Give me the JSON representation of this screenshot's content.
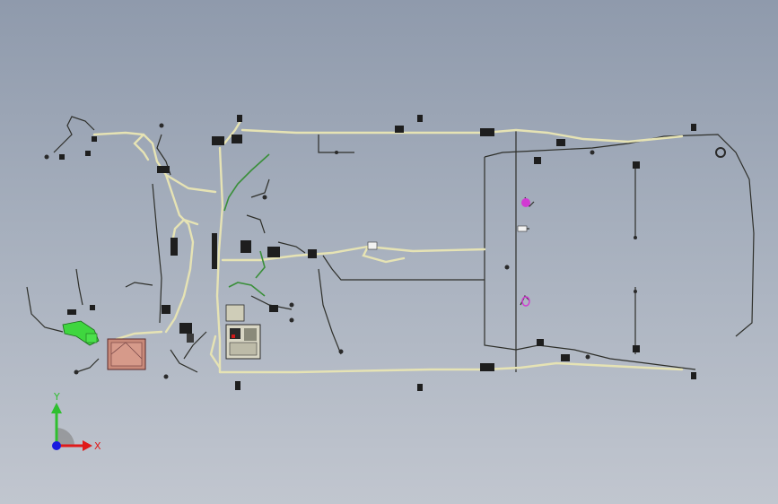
{
  "viewport": {
    "background_top": "#8f9aac",
    "background_bottom": "#c1c6cf"
  },
  "model": {
    "description_visible": false,
    "wire_color": "#e6e3b4",
    "wire_dark_color": "#2e2f2a",
    "branch_color": "#3a8f3a",
    "connector_color": "#1e1e1e",
    "relay_box_color": "#c98a7a",
    "accent_green": "#3fd63f",
    "accent_magenta": "#d23ad2"
  },
  "triad": {
    "x_label": "X",
    "y_label": "Y",
    "x_color": "#e01a1a",
    "y_color": "#2fbf2f",
    "z_color": "#1a1ae0"
  }
}
